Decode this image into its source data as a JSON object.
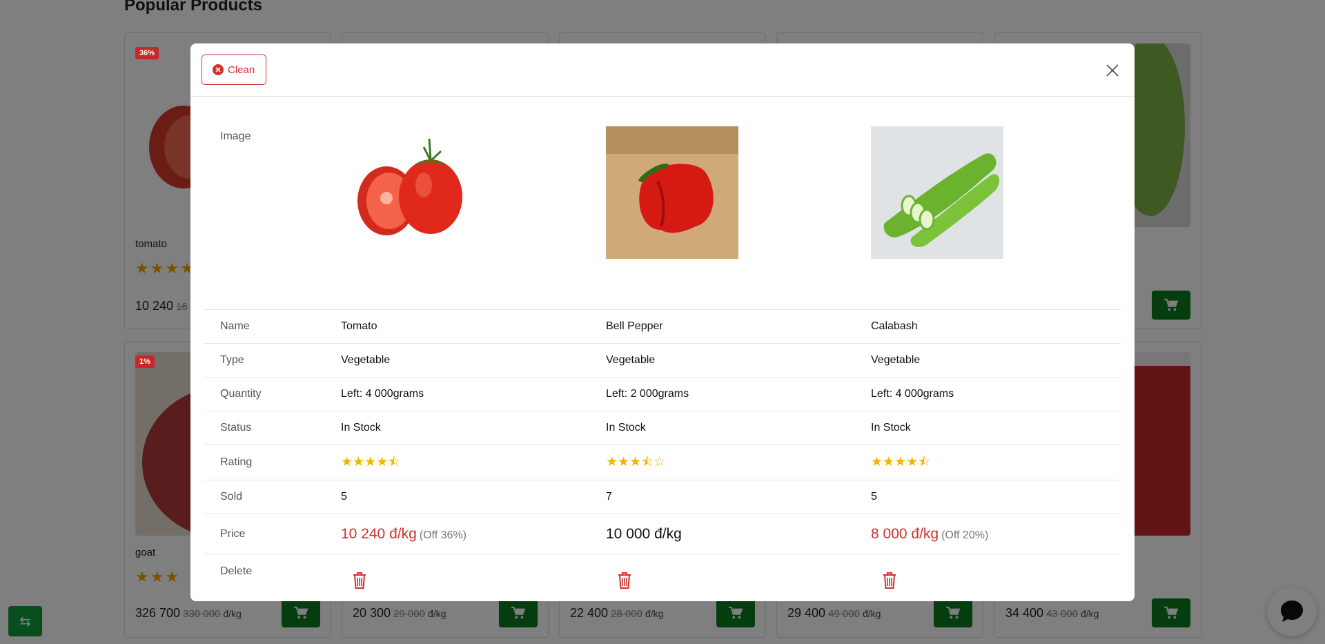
{
  "background": {
    "section_title": "Popular Products",
    "cards_top": [
      {
        "badge": "36%",
        "name": "tomato",
        "price": "10 240",
        "old_price": "16",
        "unit": ""
      },
      {
        "badge": "",
        "name": "",
        "price": "",
        "old_price": "",
        "unit": ""
      },
      {
        "badge": "",
        "name": "",
        "price": "",
        "old_price": "",
        "unit": ""
      },
      {
        "badge": "",
        "name": "",
        "price": "",
        "old_price": "",
        "unit": ""
      },
      {
        "badge": "",
        "name": "",
        "price": "",
        "old_price": "",
        "unit": ""
      }
    ],
    "cards_bottom": [
      {
        "badge": "1%",
        "name": "goat",
        "price": "326 700",
        "old_price": "330 000",
        "unit": "đ/kg"
      },
      {
        "badge": "",
        "name": "",
        "price": "20 300",
        "old_price": "29 000",
        "unit": "đ/kg"
      },
      {
        "badge": "",
        "name": "",
        "price": "22 400",
        "old_price": "28 000",
        "unit": "đ/kg"
      },
      {
        "badge": "",
        "name": "",
        "price": "29 400",
        "old_price": "49 000",
        "unit": "đ/kg"
      },
      {
        "badge": "",
        "name": "",
        "price": "34 400",
        "old_price": "43 000",
        "unit": "đ/kg"
      }
    ]
  },
  "modal": {
    "clean_label": "Clean",
    "labels": {
      "image": "Image",
      "name": "Name",
      "type": "Type",
      "quantity": "Quantity",
      "status": "Status",
      "rating": "Rating",
      "sold": "Sold",
      "price": "Price",
      "delete": "Delete"
    },
    "products": [
      {
        "name": "Tomato",
        "type": "Vegetable",
        "quantity": "Left: 4 000grams",
        "status": "In Stock",
        "rating": 4.5,
        "sold": "5",
        "price": "10 240 đ/kg",
        "off": "(Off 36%)",
        "price_color": "#d32f2f"
      },
      {
        "name": "Bell Pepper",
        "type": "Vegetable",
        "quantity": "Left: 2 000grams",
        "status": "In Stock",
        "rating": 3.5,
        "sold": "7",
        "price": "10 000 đ/kg",
        "off": "",
        "price_color": "#111111"
      },
      {
        "name": "Calabash",
        "type": "Vegetable",
        "quantity": "Left: 4 000grams",
        "status": "In Stock",
        "rating": 4.5,
        "sold": "5",
        "price": "8 000 đ/kg",
        "off": "(Off 20%)",
        "price_color": "#d32f2f"
      }
    ]
  },
  "colors": {
    "accent_red": "#d32f2f",
    "cart_green": "#0b7a1e",
    "star_yellow": "#f4b400"
  }
}
